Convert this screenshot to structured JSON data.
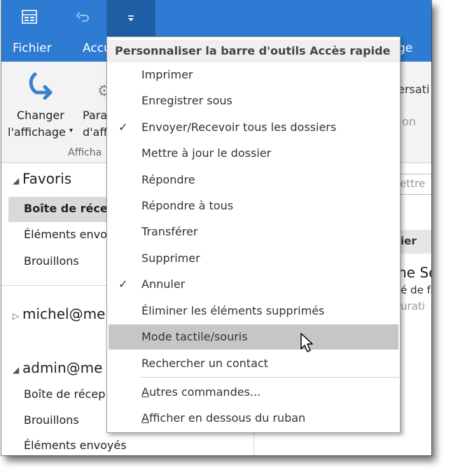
{
  "titlebar": {
    "qat_icons": [
      "send-receive-icon",
      "undo-icon",
      "customize-qat-icon"
    ]
  },
  "tabs": {
    "file": "Fichier",
    "home_partial": "Accu",
    "right_partial": "ge"
  },
  "ribbon": {
    "change_view_line1": "Changer",
    "change_view_line2": "l'affichage",
    "params_line1": "Para",
    "params_line2": "d'aff",
    "group_label": "Afficha",
    "conv_partial": "ersati",
    "on_partial": "on"
  },
  "folders": {
    "favorites": "Favoris",
    "inbox": "Boîte de réce",
    "sent": "Éléments envo",
    "drafts": "Brouillons",
    "account1": "michel@me",
    "account2": "admin@me",
    "acc2_inbox": "Boîte de récep",
    "acc2_drafts": "Brouillons",
    "acc2_sent": "Éléments envoyés"
  },
  "right_pane": {
    "search_partial": "ettre",
    "col_partial": "ier",
    "preview_name": "ne Se",
    "preview_line2": "é de fa",
    "preview_line3": "urati"
  },
  "menu": {
    "title": "Personnaliser la barre d'outils Accès rapide",
    "items": [
      {
        "label": "Imprimer",
        "checked": false
      },
      {
        "label": "Enregistrer sous",
        "checked": false
      },
      {
        "label": "Envoyer/Recevoir tous les dossiers",
        "checked": true
      },
      {
        "label": "Mettre à jour le dossier",
        "checked": false
      },
      {
        "label": "Répondre",
        "checked": false
      },
      {
        "label": "Répondre à tous",
        "checked": false
      },
      {
        "label": "Transférer",
        "checked": false
      },
      {
        "label": "Supprimer",
        "checked": false
      },
      {
        "label": "Annuler",
        "checked": true
      },
      {
        "label": "Éliminer les éléments supprimés",
        "checked": false
      },
      {
        "label": "Mode tactile/souris",
        "checked": false,
        "highlighted": true
      },
      {
        "label": "Rechercher un contact",
        "checked": false
      },
      {
        "label": "Autres commandes...",
        "checked": false
      },
      {
        "label": "Afficher en dessous du ruban",
        "checked": false
      }
    ],
    "check_glyph": "✓"
  },
  "colors": {
    "accent": "#2d7bd3",
    "accent_dark": "#1f5fa6",
    "hover": "#c6c6c6",
    "selected": "#d9d9d9"
  }
}
